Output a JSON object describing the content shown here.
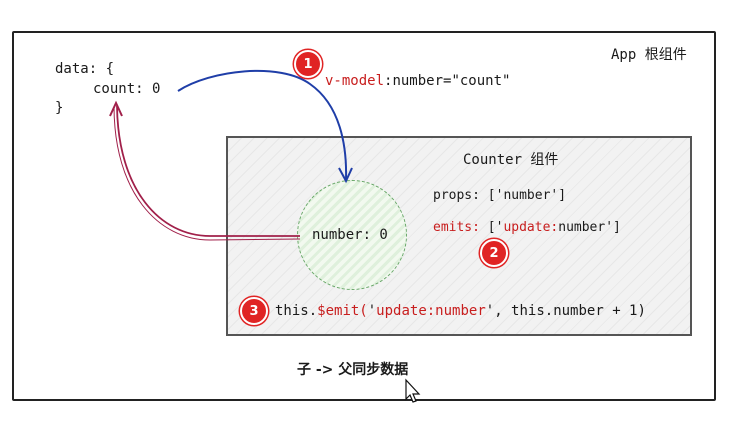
{
  "app": {
    "title": "App  根组件"
  },
  "data_block": {
    "line1": "data: {",
    "line2": "count: 0",
    "line3": "}"
  },
  "binding": {
    "directive": "v-model",
    "rest": ":number=\"count\""
  },
  "counter": {
    "title": "Counter 组件",
    "props": "props: ['number']",
    "emits_key": "emits:",
    "emits_open": " ['",
    "emits_value": "update:",
    "emits_close": "number']",
    "circle_label": "number: 0"
  },
  "emit_call": {
    "prefix": "this.",
    "method": "$emit(",
    "arg_open": "'",
    "arg_value": "update:number",
    "arg_close": "'",
    "rest": ", this.number + 1)"
  },
  "badges": [
    "1",
    "2",
    "3"
  ],
  "caption": "子 -> 父同步数据",
  "colors": {
    "blue_arrow": "#1f3ea8",
    "red_arrow": "#a1204a",
    "badge": "#e02424",
    "red_text": "#c81e1e"
  }
}
